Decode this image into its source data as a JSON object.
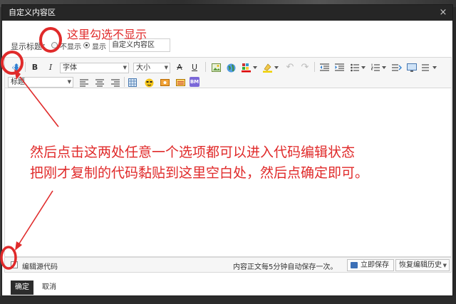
{
  "dialog": {
    "title": "自定义内容区",
    "close": "×"
  },
  "title_row": {
    "label": "显示标题：",
    "option_hide": "不显示",
    "option_show": "显示",
    "selected": "显示",
    "input_value": "自定义内容区"
  },
  "toolbar": {
    "bold": "B",
    "italic": "I",
    "font_family": "字体",
    "font_size": "大小",
    "strike": "A",
    "underline": "U",
    "heading": "标题",
    "icons": [
      "source-code-icon",
      "bold-icon",
      "italic-icon",
      "strikethrough-icon",
      "underline-icon",
      "image-icon",
      "globe-icon",
      "font-color-icon",
      "highlight-color-icon",
      "undo-icon",
      "redo-icon",
      "outdent-icon",
      "indent-icon",
      "bullet-list-icon",
      "numbered-list-icon",
      "link-icon",
      "monitor-icon",
      "align-left-icon",
      "align-center-icon",
      "align-right-icon",
      "table-icon",
      "emoji-icon",
      "media-icon",
      "flash-icon",
      "bm-icon"
    ],
    "bm_label": "BM"
  },
  "status": {
    "source_label": "编辑源代码",
    "autosave": "内容正文每5分钟自动保存一次。",
    "save_now": "立即保存",
    "restore": "恢复编辑历史"
  },
  "footer": {
    "ok": "确定",
    "cancel": "取消"
  },
  "annotations": {
    "check_hint": "这里勾选不显示",
    "line1": "然后点击这两处任意一个选项都可以进入代码编辑状态",
    "line2": "把刚才复制的代码黏贴到这里空白处，然后点确定即可。"
  },
  "colors": {
    "annotation": "#e02a2a",
    "titlebar": "#262626",
    "accent_blue": "#3b6fb6"
  }
}
